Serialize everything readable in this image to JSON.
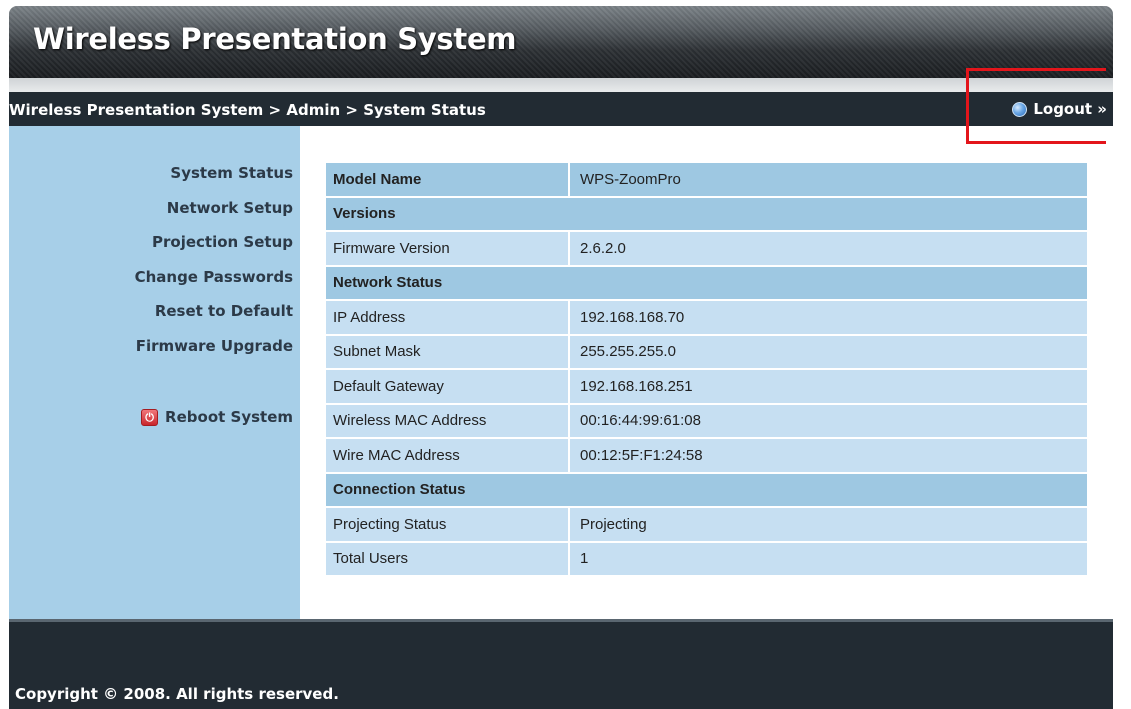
{
  "header": {
    "title": "Wireless Presentation System"
  },
  "breadcrumb": {
    "items": [
      "Wireless Presentation System",
      "Admin",
      "System Status"
    ],
    "separator": ">"
  },
  "logout": {
    "label": "Logout »",
    "icon": "globe-icon"
  },
  "sidebar": {
    "items": [
      {
        "label": "System Status"
      },
      {
        "label": "Network Setup"
      },
      {
        "label": "Projection Setup"
      },
      {
        "label": "Change Passwords"
      },
      {
        "label": "Reset to Default"
      },
      {
        "label": "Firmware Upgrade"
      }
    ],
    "reboot": {
      "label": "Reboot System",
      "icon": "power-icon"
    }
  },
  "status": {
    "model": {
      "label": "Model Name",
      "value": "WPS-ZoomPro"
    },
    "versions_header": "Versions",
    "firmware": {
      "label": "Firmware Version",
      "value": "2.6.2.0"
    },
    "network_header": "Network Status",
    "ip": {
      "label": "IP Address",
      "value": "192.168.168.70"
    },
    "subnet": {
      "label": "Subnet Mask",
      "value": "255.255.255.0"
    },
    "gateway": {
      "label": "Default Gateway",
      "value": "192.168.168.251"
    },
    "wireless_mac": {
      "label": "Wireless MAC Address",
      "value": "00:16:44:99:61:08"
    },
    "wire_mac": {
      "label": "Wire MAC Address",
      "value": "00:12:5F:F1:24:58"
    },
    "connection_header": "Connection Status",
    "projecting": {
      "label": "Projecting Status",
      "value": "Projecting"
    },
    "users": {
      "label": "Total Users",
      "value": "1"
    }
  },
  "footer": {
    "copyright": "Copyright © 2008. All rights reserved."
  },
  "colors": {
    "nav_dark": "#222b33",
    "sidebar": "#a7cfe8",
    "section_row": "#9ec8e2",
    "data_row": "#c6dff2",
    "annotation": "#e3151b"
  }
}
